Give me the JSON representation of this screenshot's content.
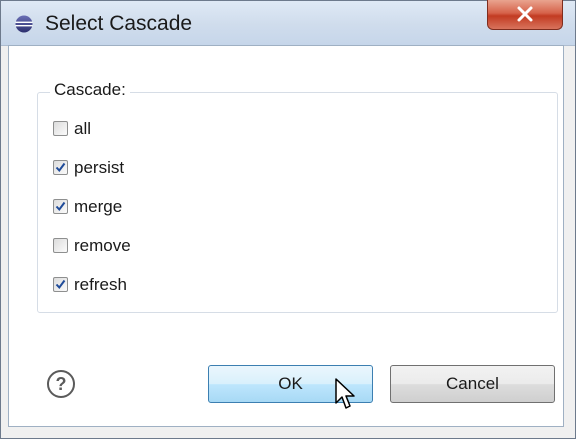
{
  "window": {
    "title": "Select Cascade"
  },
  "group": {
    "label": "Cascade:"
  },
  "options": [
    {
      "label": "all",
      "checked": false
    },
    {
      "label": "persist",
      "checked": true
    },
    {
      "label": "merge",
      "checked": true
    },
    {
      "label": "remove",
      "checked": false
    },
    {
      "label": "refresh",
      "checked": true
    }
  ],
  "buttons": {
    "ok": "OK",
    "cancel": "Cancel"
  },
  "icons": {
    "app": "eclipse-icon",
    "close": "close-icon",
    "help": "help-icon",
    "cursor": "mouse-cursor-icon"
  },
  "colors": {
    "title_bar": "#cfdcec",
    "close_button": "#c23b22",
    "ok_button_border": "#3c7fb1",
    "checkmark": "#1f4b99"
  }
}
